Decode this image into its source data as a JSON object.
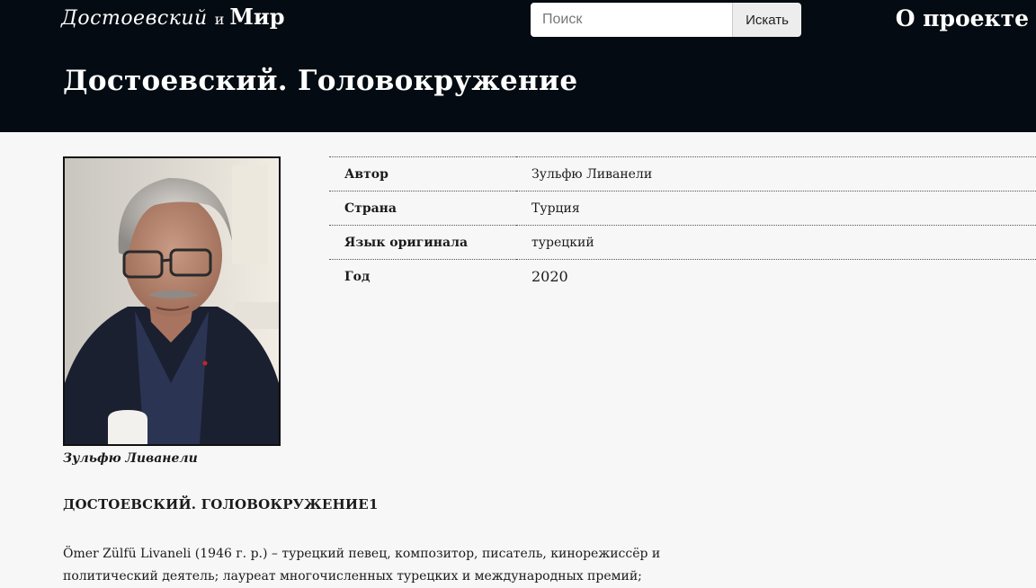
{
  "header": {
    "brand_script": "Достоевский",
    "brand_and": "и",
    "brand_mir": "Мир",
    "search_placeholder": "Поиск",
    "search_button": "Искать",
    "about_link": "О проекте",
    "page_title": "Достоевский. Головокружение"
  },
  "portrait": {
    "caption": "Зульфю Ливанели"
  },
  "info": [
    {
      "key": "Автор",
      "value": "Зульфю Ливанели"
    },
    {
      "key": "Страна",
      "value": "Турция"
    },
    {
      "key": "Язык оригинала",
      "value": "турецкий"
    },
    {
      "key": "Год",
      "value": "2020"
    }
  ],
  "article": {
    "heading": "ДОСТОЕВСКИЙ. ГОЛОВОКРУЖЕНИЕ1",
    "body": "Ömer Zülfü Livaneli (1946 г. р.) – турецкий певец, композитор, писатель, кинорежиссёр и политический деятель; лауреат многочисленных турецких и международных премий;"
  },
  "colors": {
    "header_bg": "#040b12",
    "page_bg": "#f7f7f7"
  }
}
